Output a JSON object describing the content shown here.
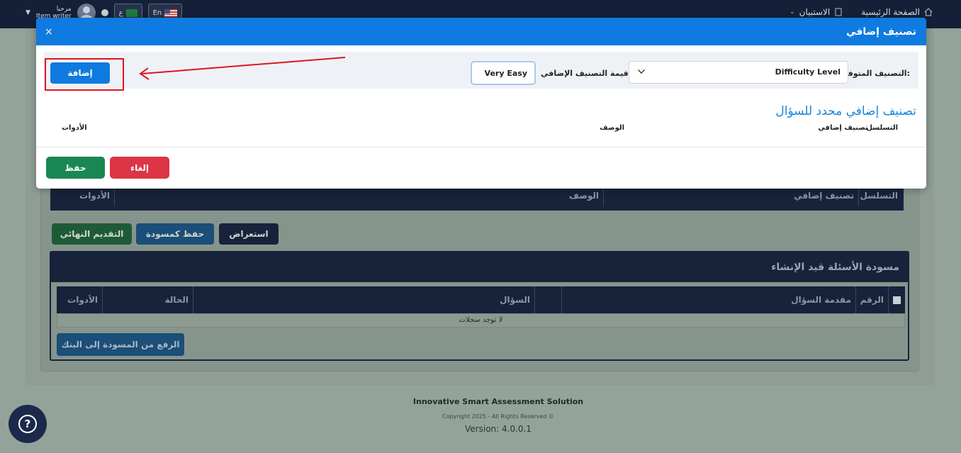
{
  "navbar": {
    "greeting": "مرحبا",
    "username": "Item writer",
    "lang_ar": "ع",
    "lang_en": "En",
    "home": "الصفحة الرئيسية",
    "surveys": "الاستبيان"
  },
  "background": {
    "table1_headers": [
      "التسلسل",
      "تصنيف إضافي",
      "الوصف",
      "الأدوات"
    ],
    "btn_preview": "استعراض",
    "btn_save_draft": "حفظ كمسودة",
    "btn_final_submit": "التقديم النهائي",
    "drafts_title": "مسودة الأسئلة قيد الإنشاء",
    "drafts_headers": [
      "الرقم",
      "مقدمة السؤال",
      "",
      "السؤال",
      "الحالة",
      "الأدوات"
    ],
    "no_records": "لا توجد سجلات",
    "upload_btn": "الرفع من المسودة إلى البنك"
  },
  "footer": {
    "product": "Innovative Smart Assessment Solution",
    "copyright": "Copyright 2025 - All Rights Reserved ©",
    "version": "Version: 4.0.0.1"
  },
  "modal": {
    "title": "تصنيف إضافي",
    "close": "×",
    "available_label": "التصنيف المتوفر:",
    "available_value": "Difficulty Level",
    "value_label": "قيمة التصنيف الإضافي",
    "value_input": "Very Easy",
    "add_btn": "إضافة",
    "section_title": "تصنيف إضافي محدد للسؤال",
    "col_seq": "التسلسل",
    "col_classification": "تصنيف إضافي",
    "col_desc": "الوصف",
    "col_tools": "الأدوات",
    "cancel_btn": "إلغاء",
    "save_btn": "حفظ"
  },
  "colors": {
    "primary": "#0f7ae0",
    "danger": "#dc3545",
    "success": "#198754",
    "navbar": "#142038",
    "annotation": "#e0151f"
  }
}
